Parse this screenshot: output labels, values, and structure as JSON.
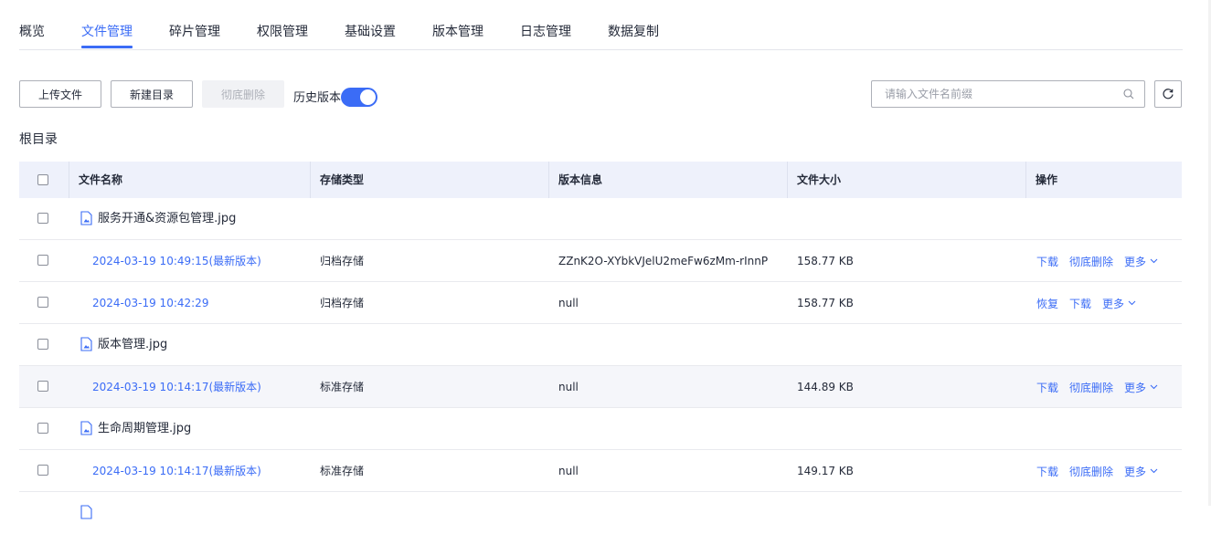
{
  "tabs": [
    "概览",
    "文件管理",
    "碎片管理",
    "权限管理",
    "基础设置",
    "版本管理",
    "日志管理",
    "数据复制"
  ],
  "active_tab": "文件管理",
  "toolbar": {
    "upload_label": "上传文件",
    "new_dir_label": "新建目录",
    "delete_label": "彻底删除",
    "history_label": "历史版本",
    "history_enabled": true
  },
  "search": {
    "placeholder": "请输入文件名前缀",
    "value": ""
  },
  "breadcrumb": "根目录",
  "table": {
    "headers": [
      "文件名称",
      "存储类型",
      "版本信息",
      "文件大小",
      "操作"
    ],
    "rows": [
      {
        "kind": "file",
        "name": "服务开通&资源包管理.jpg"
      },
      {
        "kind": "version",
        "time": "2024-03-19 10:49:15(最新版本)",
        "storage": "归档存储",
        "version": "ZZnK2O-XYbkVJelU2meFw6zMm-rInnP",
        "size": "158.77 KB",
        "actions": [
          "下载",
          "彻底删除"
        ],
        "more": "更多"
      },
      {
        "kind": "version",
        "time": "2024-03-19 10:42:29",
        "storage": "归档存储",
        "version": "null",
        "size": "158.77 KB",
        "actions": [
          "恢复",
          "下载"
        ],
        "more": "更多"
      },
      {
        "kind": "file",
        "name": "版本管理.jpg"
      },
      {
        "kind": "version",
        "time": "2024-03-19 10:14:17(最新版本)",
        "storage": "标准存储",
        "version": "null",
        "size": "144.89 KB",
        "actions": [
          "下载",
          "彻底删除"
        ],
        "more": "更多",
        "highlight": true
      },
      {
        "kind": "file",
        "name": "生命周期管理.jpg"
      },
      {
        "kind": "version",
        "time": "2024-03-19 10:14:17(最新版本)",
        "storage": "标准存储",
        "version": "null",
        "size": "149.17 KB",
        "actions": [
          "下载",
          "彻底删除"
        ],
        "more": "更多"
      }
    ]
  },
  "colors": {
    "accent": "#3b6cf6",
    "header_bg": "#eef1fb",
    "border": "#adb0b8"
  },
  "icons": {
    "file": "image-file-icon",
    "search": "search-icon",
    "refresh": "refresh-icon",
    "more": "chevron-down-icon"
  }
}
